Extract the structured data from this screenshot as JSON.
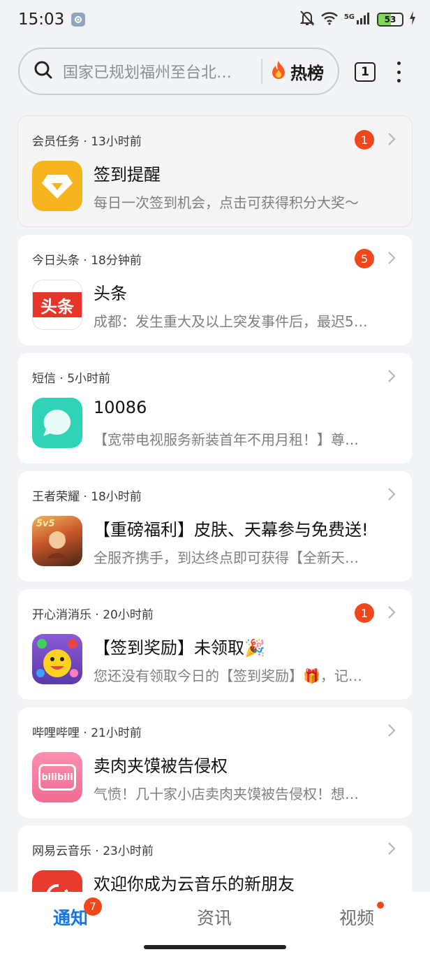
{
  "status_bar": {
    "time": "15:03",
    "network": "5G",
    "battery": "53"
  },
  "search": {
    "placeholder": "国家已规划福州至台北…",
    "hot_label": "热榜",
    "tab_count": "1"
  },
  "notifications": [
    {
      "source": "会员任务",
      "time": "13小时前",
      "badge": "1",
      "title": "签到提醒",
      "body": "每日一次签到机会，点击可获得积分大奖～",
      "icon": "diamond-app-icon"
    },
    {
      "source": "今日头条",
      "time": "18分钟前",
      "badge": "5",
      "title": "头条",
      "body": "成都：发生重大及以上突发事件后，最迟5…",
      "icon": "toutiao-app-icon",
      "icon_text": "头条"
    },
    {
      "source": "短信",
      "time": "5小时前",
      "badge": "",
      "title": "10086",
      "body": "【宽带电视服务新装首年不用月租！】尊…",
      "icon": "messages-app-icon"
    },
    {
      "source": "王者荣耀",
      "time": "18小时前",
      "badge": "",
      "title": "【重磅福利】皮肤、天幕参与免费送!",
      "body": "全服齐携手，到达终点即可获得【全新天…",
      "icon": "honor-of-kings-app-icon",
      "icon_text": "5v5"
    },
    {
      "source": "开心消消乐",
      "time": "20小时前",
      "badge": "1",
      "title": "【签到奖励】未领取🎉",
      "body": "您还没有领取今日的【签到奖励】🎁，记…",
      "icon": "happy-elimination-app-icon"
    },
    {
      "source": "哔哩哔哩",
      "time": "21小时前",
      "badge": "",
      "title": "卖肉夹馍被告侵权",
      "body": "气愤！几十家小店卖肉夹馍被告侵权！想…",
      "icon": "bilibili-app-icon",
      "icon_text": "bilibili"
    },
    {
      "source": "网易云音乐",
      "time": "23小时前",
      "badge": "",
      "title": "欢迎你成为云音乐的新朋友",
      "body": "",
      "icon": "netease-music-app-icon"
    }
  ],
  "bottom_nav": {
    "notify": "通知",
    "notify_badge": "7",
    "news": "资讯",
    "video": "视频"
  },
  "colors": {
    "accent": "#1676e6",
    "badge": "#f2471b",
    "background": "#f1f3f5"
  }
}
